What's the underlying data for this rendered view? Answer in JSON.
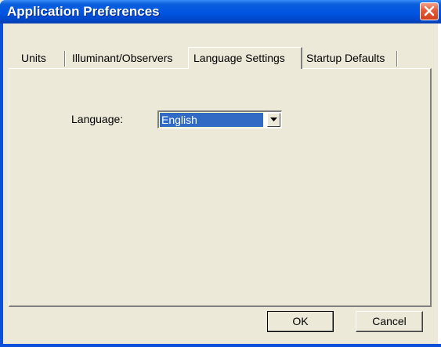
{
  "window": {
    "title": "Application Preferences"
  },
  "tabs": [
    {
      "label": "Units",
      "active": false
    },
    {
      "label": "Illuminant/Observers",
      "active": false
    },
    {
      "label": "Language Settings",
      "active": true
    },
    {
      "label": "Startup Defaults",
      "active": false
    }
  ],
  "language": {
    "label": "Language:",
    "selected": "English"
  },
  "buttons": {
    "ok": "OK",
    "cancel": "Cancel"
  },
  "colors": {
    "titlebar": "#0054e3",
    "close": "#d2411e",
    "selection": "#316ac5",
    "face": "#ece9d8"
  }
}
